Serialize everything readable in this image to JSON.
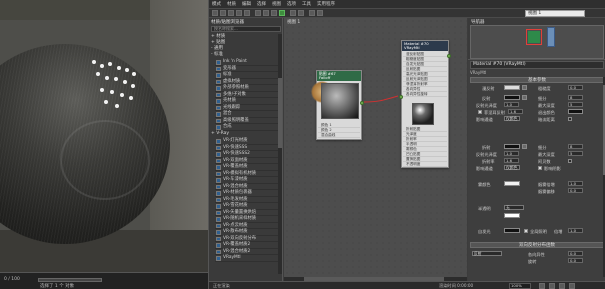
{
  "window": {
    "title": "材质/贴图浏览器"
  },
  "viewport": {
    "status_text": "选择了 1 个 对象",
    "frame_label": "0 / 100"
  },
  "menubar": {
    "items": [
      "模式",
      "材质",
      "编辑",
      "选择",
      "视图",
      "选项",
      "工具",
      "实用程序"
    ]
  },
  "toolbar": {
    "view_name": "视图 1"
  },
  "browser": {
    "title": "材质/贴图浏览器",
    "search_placeholder": "按名称搜索...",
    "groups": [
      {
        "label": "+ 材质"
      },
      {
        "label": "+ 贴图"
      },
      {
        "label": "- 通用"
      },
      {
        "label": "- 标准"
      },
      {
        "label": "+ V-Ray"
      }
    ],
    "materials": [
      "Ink 'n Paint",
      "变形器",
      "标准",
      "虚拟材质",
      "外部参照材质",
      "多维/子对象",
      "壳材质",
      "光线跟踪",
      "混合",
      "高级照明覆盖",
      "合成",
      "VR-灯光材质",
      "VR-快速SSS",
      "VR-快速SSS2",
      "VR-双面材质",
      "VR-覆盖材质",
      "VR-模拟有机材质",
      "VR-车漆材质",
      "VR-混合材质",
      "VR-材质包裹器",
      "VR-毛发材质",
      "VR-雪花材质",
      "VR-矢量置换烘焙",
      "VR-随机采样材质",
      "VR-点云材质",
      "VR-散布材质",
      "VR-双向反射分布",
      "VR-覆盖材质2",
      "VR-混合材质2",
      "VRayMtl"
    ]
  },
  "nodeview": {
    "title": "视图 1",
    "falloff_node": {
      "name": "贴图 #67",
      "type": "Falloff",
      "slots": [
        "颜色 1",
        "颜色 2",
        "混合曲线"
      ]
    },
    "material_node": {
      "name": "Material #70",
      "type": "VRayMtl",
      "slots": [
        "漫反射贴图",
        "粗糙度贴图",
        "自发光贴图",
        "反射贴图",
        "高光光泽贴图",
        "反射光泽贴图",
        "菲涅耳折射率",
        "各向异性",
        "各向异性旋转",
        "折射贴图",
        "光泽度",
        "折射率",
        "半透明",
        "雾颜色",
        "凹凸贴图",
        "置换贴图",
        "不透明度",
        "环境贴图"
      ]
    }
  },
  "navigator": {
    "title": "导航器"
  },
  "params": {
    "header": "Material #70 (VRayMtl)",
    "subheader": "VRayMtl",
    "rollout_basic": "基本参数",
    "labels": {
      "diffuse": "漫反射",
      "roughness": "粗糙度",
      "reflect": "反射",
      "gloss": "反射光泽度",
      "fresnel": "菲涅耳反射",
      "refract": "折射",
      "ior": "折射率",
      "fog_color": "雾颜色",
      "translucent": "半透明",
      "brdf_rollout": "双向反射分布函数",
      "anisotropy": "各向异性",
      "rotation": "旋转",
      "brdf_type": "反射",
      "subdivs": "细分",
      "max_depth": "最大深度",
      "exit_color": "退出颜色",
      "affect_channels": "影响通道",
      "dim_distance": "暗淡距离",
      "abbe": "阿贝数",
      "fog_multiplier": "烟雾倍增",
      "fog_bias": "烟雾偏移",
      "affect_shadows": "影响阴影",
      "self_illum": "自发光",
      "gi": "全局照明",
      "multiplier": "倍增"
    },
    "values": {
      "roughness": "0.0",
      "gloss": "1.0",
      "fresnel_ior": "1.6",
      "subdivs": "8",
      "max_depth": "5",
      "ior": "1.6",
      "refract_gloss": "1.0",
      "refract_subdivs": "8",
      "refract_depth": "5",
      "fog_multiplier": "1.0",
      "fog_bias": "0.0",
      "self_illum_mult": "1.0",
      "anisotropy": "0.0",
      "rotation": "0.0"
    },
    "dropdowns": {
      "affect_channels": "仅颜色",
      "refract_channels": "仅颜色",
      "translucent": "无",
      "brdf": "反射"
    }
  },
  "statusbar": {
    "left_text": "正在渲染",
    "zoom_label": "100%",
    "info": "渲染时间 0:00:00"
  }
}
